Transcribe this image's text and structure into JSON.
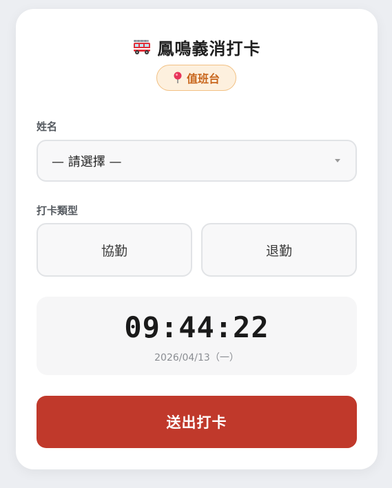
{
  "header": {
    "title": "鳳鳴義消打卡",
    "icon": "fire-truck-icon"
  },
  "badge": {
    "label": "值班台",
    "icon": "pin-icon"
  },
  "name_field": {
    "label": "姓名",
    "selected": "— 請選擇 —"
  },
  "punch_type": {
    "label": "打卡類型",
    "options": [
      "協勤",
      "退勤"
    ]
  },
  "clock": {
    "time": "09:44:22",
    "date": "2026/04/13（一）"
  },
  "submit": {
    "label": "送出打卡"
  },
  "colors": {
    "accent": "#c0392b",
    "badge_bg": "#fdf0de",
    "badge_text": "#c8651b"
  }
}
